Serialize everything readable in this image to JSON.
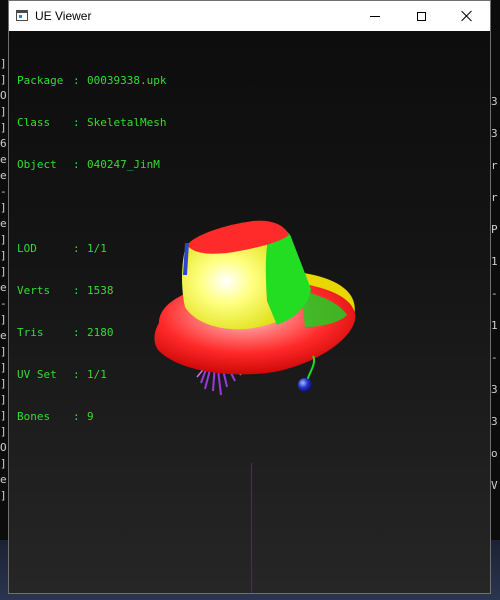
{
  "window": {
    "title": "UE Viewer"
  },
  "info": {
    "package_label": "Package",
    "package_value": "00039338.upk",
    "class_label": "Class",
    "class_value": "SkeletalMesh",
    "object_label": "Object",
    "object_value": "040247_JinM",
    "lod_label": "LOD",
    "lod_value": "1/1",
    "verts_label": "Verts",
    "verts_value": "1538",
    "tris_label": "Tris",
    "tris_value": "2180",
    "uvset_label": "UV Set",
    "uvset_value": "1/1",
    "bones_label": "Bones",
    "bones_value": "9",
    "separator": ":"
  },
  "icons": {
    "app": "app-window-icon",
    "minimize": "minimize-icon",
    "maximize": "maximize-icon",
    "close": "close-icon"
  },
  "colors": {
    "info_text": "#33dd33",
    "viewport_bg": "#141414",
    "axis": "#1d2fc6",
    "mesh_red": "#ff2a2a",
    "mesh_yellow": "#f2f200",
    "mesh_green": "#22dd22"
  },
  "bg_console": {
    "left": [
      "]",
      "]",
      "O",
      "]",
      "]",
      "6",
      "e",
      "e",
      "-",
      "]",
      "e",
      "]",
      "]",
      "]",
      "e",
      "-",
      "]",
      "e",
      "]",
      "]",
      "]",
      "]",
      "]",
      "]",
      "O",
      "]",
      "e",
      "]"
    ],
    "right": [
      "3",
      "3",
      "r",
      "r",
      "P",
      "1",
      "-",
      "1",
      "-",
      "3",
      "3",
      "o",
      "V"
    ]
  }
}
